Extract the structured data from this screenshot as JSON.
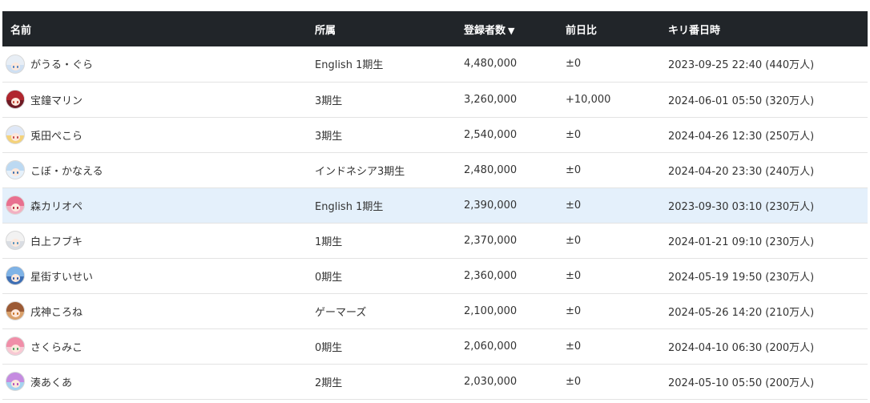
{
  "table": {
    "headers": {
      "name": "名前",
      "group": "所属",
      "subscribers": "登録者数",
      "sort_arrow": "▼",
      "diff": "前日比",
      "milestone": "キリ番日時"
    },
    "rows": [
      {
        "name": "がうる・ぐら",
        "group": "English 1期生",
        "subscribers": "4,480,000",
        "diff": "±0",
        "milestone": "2023-09-25 22:40 (440万人)",
        "avatar_icon": "gawr-gura-avatar-icon",
        "avatar_hair": "#e8eef5",
        "avatar_bg": "#cfe0f3",
        "avatar_eye": "#4a7fc1"
      },
      {
        "name": "宝鐘マリン",
        "group": "3期生",
        "subscribers": "3,260,000",
        "diff": "+10,000",
        "milestone": "2024-06-01 05:50 (320万人)",
        "avatar_icon": "houshou-marine-avatar-icon",
        "avatar_hair": "#b0262e",
        "avatar_bg": "#6e1a24",
        "avatar_eye": "#c23b2b"
      },
      {
        "name": "兎田ぺこら",
        "group": "3期生",
        "subscribers": "2,540,000",
        "diff": "±0",
        "milestone": "2024-04-26 12:30 (250万人)",
        "avatar_icon": "usada-pekora-avatar-icon",
        "avatar_hair": "#dfe8f7",
        "avatar_bg": "#f4d27a",
        "avatar_eye": "#c2484b"
      },
      {
        "name": "こぼ・かなえる",
        "group": "インドネシア3期生",
        "subscribers": "2,480,000",
        "diff": "±0",
        "milestone": "2024-04-20 23:30 (240万人)",
        "avatar_icon": "kobo-kanaeru-avatar-icon",
        "avatar_hair": "#bcd9f2",
        "avatar_bg": "#e6f1fb",
        "avatar_eye": "#3a6fb0"
      },
      {
        "name": "森カリオペ",
        "group": "English 1期生",
        "subscribers": "2,390,000",
        "diff": "±0",
        "milestone": "2023-09-30 03:10 (230万人)",
        "avatar_icon": "mori-calliope-avatar-icon",
        "avatar_hair": "#e8708f",
        "avatar_bg": "#f3b0c2",
        "avatar_eye": "#b0203c"
      },
      {
        "name": "白上フブキ",
        "group": "1期生",
        "subscribers": "2,370,000",
        "diff": "±0",
        "milestone": "2024-01-21 09:10 (230万人)",
        "avatar_icon": "shirakami-fubuki-avatar-icon",
        "avatar_hair": "#f2f2f2",
        "avatar_bg": "#d9dde3",
        "avatar_eye": "#4e8fbf"
      },
      {
        "name": "星街すいせい",
        "group": "0期生",
        "subscribers": "2,360,000",
        "diff": "±0",
        "milestone": "2024-05-19 19:50 (230万人)",
        "avatar_icon": "hoshimachi-suisei-avatar-icon",
        "avatar_hair": "#7fb3e6",
        "avatar_bg": "#3e6fb4",
        "avatar_eye": "#2a56a5"
      },
      {
        "name": "戌神ころね",
        "group": "ゲーマーズ",
        "subscribers": "2,100,000",
        "diff": "±0",
        "milestone": "2024-05-26 14:20 (210万人)",
        "avatar_icon": "inugami-korone-avatar-icon",
        "avatar_hair": "#9b5a35",
        "avatar_bg": "#d9a06b",
        "avatar_eye": "#c87020"
      },
      {
        "name": "さくらみこ",
        "group": "0期生",
        "subscribers": "2,060,000",
        "diff": "±0",
        "milestone": "2024-04-10 06:30 (200万人)",
        "avatar_icon": "sakura-miko-avatar-icon",
        "avatar_hair": "#f08ea8",
        "avatar_bg": "#f8c9d4",
        "avatar_eye": "#3c9a5a"
      },
      {
        "name": "湊あくあ",
        "group": "2期生",
        "subscribers": "2,030,000",
        "diff": "±0",
        "milestone": "2024-05-10 05:50 (200万人)",
        "avatar_icon": "minato-aqua-avatar-icon",
        "avatar_hair": "#c58be0",
        "avatar_bg": "#a4d2f0",
        "avatar_eye": "#b04ab8"
      }
    ],
    "highlighted_row_index": 4,
    "colors": {
      "header_bg": "#212529",
      "header_text": "#ffffff",
      "highlight_row_bg": "#e4f0fb",
      "row_border": "#e3e3e3"
    }
  }
}
